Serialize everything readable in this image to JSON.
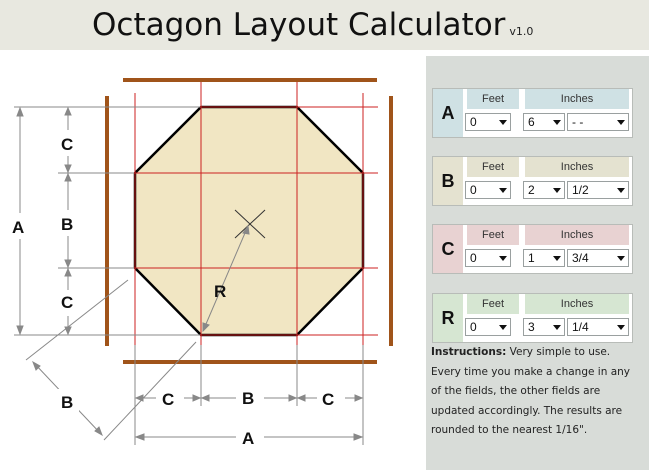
{
  "app": {
    "title": "Octagon Layout Calculator",
    "version": "v1.0"
  },
  "diagram_labels": {
    "a": "A",
    "b": "B",
    "c": "C",
    "r": "R"
  },
  "groups": [
    {
      "letter": "A",
      "color": "#cfe1e4",
      "feet_label": "Feet",
      "inches_label": "Inches",
      "feet": "0",
      "inches": "6",
      "fraction": "- -"
    },
    {
      "letter": "B",
      "color": "#e4e2d0",
      "feet_label": "Feet",
      "inches_label": "Inches",
      "feet": "0",
      "inches": "2",
      "fraction": "1/2"
    },
    {
      "letter": "C",
      "color": "#e8d2d2",
      "feet_label": "Feet",
      "inches_label": "Inches",
      "feet": "0",
      "inches": "1",
      "fraction": "3/4"
    },
    {
      "letter": "R",
      "color": "#d6e6d2",
      "feet_label": "Feet",
      "inches_label": "Inches",
      "feet": "0",
      "inches": "3",
      "fraction": "1/4"
    }
  ],
  "instructions": {
    "heading": "Instructions:",
    "text": "Very simple to use. Every time you make a change in any of the fields, the other fields are updated accordingly. The results are rounded to the nearest 1/16\"."
  },
  "colors": {
    "octagon_fill": "#f1e6c3",
    "grid_line": "#cc2222",
    "board": "#a0541a",
    "dim_line": "#888888"
  }
}
